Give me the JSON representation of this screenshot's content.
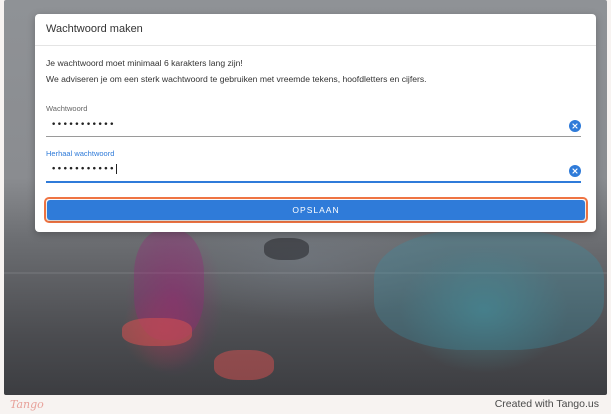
{
  "dialog": {
    "title": "Wachtwoord maken",
    "message_line1": "Je wachtwoord moet minimaal 6 karakters lang zijn!",
    "message_line2": "We adviseren je om een sterk wachtwoord te gebruiken met vreemde tekens, hoofdletters en cijfers.",
    "password_field": {
      "label": "Wachtwoord",
      "value": "•••••••••••",
      "clear_icon": "clear-circle-icon"
    },
    "repeat_password_field": {
      "label": "Herhaal wachtwoord",
      "value": "•••••••••••",
      "clear_icon": "clear-circle-icon"
    },
    "save_button": {
      "label": "OPSLAAN"
    }
  },
  "footer": {
    "logo_text": "Tango",
    "created_text": "Created with Tango.us"
  },
  "colors": {
    "accent": "#2f7bd9",
    "highlight": "#ef7443",
    "tango_logo": "#e8a19a"
  }
}
